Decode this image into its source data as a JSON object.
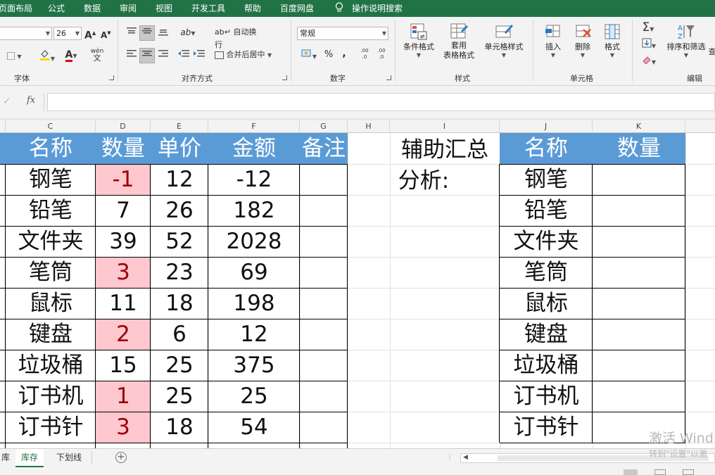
{
  "menu": [
    "页面布局",
    "公式",
    "数据",
    "审阅",
    "视图",
    "开发工具",
    "帮助",
    "百度网盘",
    "操作说明搜索"
  ],
  "ribbon": {
    "font_size": "26",
    "font_group": "字体",
    "align_group": "对齐方式",
    "wrap_text": "自动换行",
    "merge_center": "合并后居中",
    "number_format": "常规",
    "number_group": "数字",
    "cond_format": "条件格式",
    "table_format": "套用\n表格格式",
    "cell_style": "单元格样式",
    "styles_group": "样式",
    "insert": "插入",
    "delete": "删除",
    "format": "格式",
    "cells_group": "单元格",
    "sort_filter": "排序和筛选",
    "find_cut": "查",
    "edit_group": "编辑",
    "wen": "wén",
    "percent": "%",
    "comma": ",",
    "inc_decimal": ".00 .0",
    "dec_decimal": ".00 .0",
    "sigma": "Σ"
  },
  "formula_bar": {
    "cancel": "✓",
    "fx": "fx",
    "value": ""
  },
  "columns": [
    "C",
    "D",
    "E",
    "F",
    "G",
    "H",
    "I",
    "J",
    "K"
  ],
  "table": {
    "headers": [
      "名称",
      "数量",
      "单价",
      "金额",
      "备注"
    ],
    "rows": [
      [
        "钢笔",
        "-1",
        "12",
        "-12"
      ],
      [
        "铅笔",
        "7",
        "26",
        "182"
      ],
      [
        "文件夹",
        "39",
        "52",
        "2028"
      ],
      [
        "笔筒",
        "3",
        "23",
        "69"
      ],
      [
        "鼠标",
        "11",
        "18",
        "198"
      ],
      [
        "键盘",
        "2",
        "6",
        "12"
      ],
      [
        "垃圾桶",
        "15",
        "25",
        "375"
      ],
      [
        "订书机",
        "1",
        "25",
        "25"
      ],
      [
        "订书针",
        "3",
        "18",
        "54"
      ]
    ],
    "highlight_color": "#ffc7ce",
    "header_color": "#5b9bd5"
  },
  "aux_label": [
    "辅助汇总",
    "分析:"
  ],
  "summary": {
    "headers": [
      "名称",
      "数量"
    ],
    "names": [
      "钢笔",
      "铅笔",
      "文件夹",
      "笔筒",
      "鼠标",
      "键盘",
      "垃圾桶",
      "订书机",
      "订书针"
    ]
  },
  "sheet_tabs": [
    "库",
    "库存",
    "下划线"
  ],
  "watermark": {
    "line1": "激活 Wind",
    "line2": "转到\"设置\"以激"
  }
}
